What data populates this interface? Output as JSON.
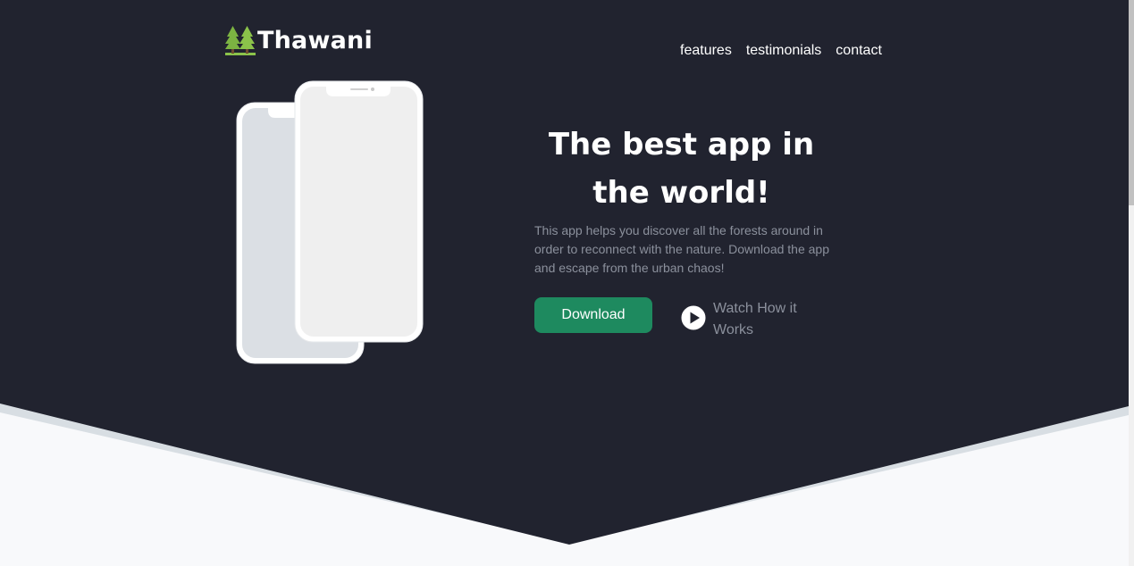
{
  "brand": {
    "name": "Thawani",
    "logo_icon": "pine-trees-icon"
  },
  "nav": {
    "items": [
      {
        "label": "features"
      },
      {
        "label": "testimonials"
      },
      {
        "label": "contact"
      }
    ]
  },
  "hero": {
    "headline": "The best app in the world!",
    "description": "This app helps you discover all the forests around in order to reconnect with the nature. Download the app and escape from the urban chaos!",
    "download_label": "Download",
    "watch_label": "Watch How it Works",
    "watch_icon": "play-icon",
    "mockup": "phone-mockups"
  },
  "colors": {
    "hero_background": "#21232f",
    "accent_green": "#1e8a5f",
    "muted_text": "#8b909c",
    "section_background": "#f8f9fb"
  }
}
